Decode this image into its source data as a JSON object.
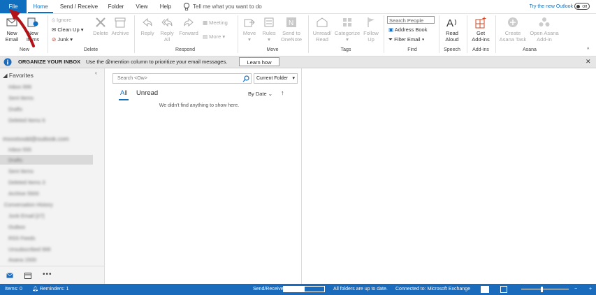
{
  "tabs": [
    "File",
    "Home",
    "Send / Receive",
    "Folder",
    "View",
    "Help"
  ],
  "tellme": "Tell me what you want to do",
  "try_new": "Try the new Outlook",
  "toggle_label": "Off",
  "ribbon": {
    "new_email": [
      "New",
      "Email"
    ],
    "new_items": [
      "New",
      "Items"
    ],
    "ignore": "Ignore",
    "cleanup": "Clean Up",
    "junk": "Junk",
    "delete": "Delete",
    "archive": "Archive",
    "reply": "Reply",
    "reply_all": [
      "Reply",
      "All"
    ],
    "forward": "Forward",
    "meeting": "Meeting",
    "more": "More",
    "move": "Move",
    "rules": "Rules",
    "send_onenote": [
      "Send to",
      "OneNote"
    ],
    "unread_read": [
      "Unread/",
      "Read"
    ],
    "categorize": "Categorize",
    "follow_up": [
      "Follow",
      "Up"
    ],
    "search_people_placeholder": "Search People",
    "address_book": "Address Book",
    "filter_email": "Filter Email",
    "read_aloud": [
      "Read",
      "Aloud"
    ],
    "get_addins": [
      "Get",
      "Add-ins"
    ],
    "create_asana": [
      "Create",
      "Asana Task"
    ],
    "open_asana": [
      "Open Asana",
      "Add-in"
    ],
    "groups": [
      "New",
      "Delete",
      "Respond",
      "Move",
      "Tags",
      "Find",
      "Speech",
      "Add-ins",
      "Asana"
    ]
  },
  "infobar": {
    "title": "ORGANIZE YOUR INBOX",
    "message": "Use the @mention column to prioritize your email messages.",
    "button": "Learn how"
  },
  "nav": {
    "favorites": "Favorites",
    "fav_items": [
      "Inbox 999",
      "Sent Items",
      "Drafts",
      "Deleted Items 6"
    ],
    "account": "mxxxtxxdd@outlook.com",
    "acct_items": [
      "Inbox 555",
      "Drafts",
      "Sent Items",
      "Deleted Items 3",
      "Archive 5500",
      "Conversation History",
      "Junk Email [27]",
      "Outbox",
      "RSS Feeds",
      "Unsubscribed 999",
      "Asana 1500"
    ]
  },
  "list": {
    "search_placeholder": "Search <Ow>",
    "scope": "Current Folder",
    "filter_all": "All",
    "filter_unread": "Unread",
    "sort": "By Date",
    "empty": "We didn't find anything to show here."
  },
  "status": {
    "items": "Items: 0",
    "reminders": "Reminders: 1",
    "send_receive": "Send/Receive",
    "all_updated": "All folders are up to date.",
    "connected": "Connected to: Microsoft Exchange"
  },
  "accent": "#106ebe"
}
